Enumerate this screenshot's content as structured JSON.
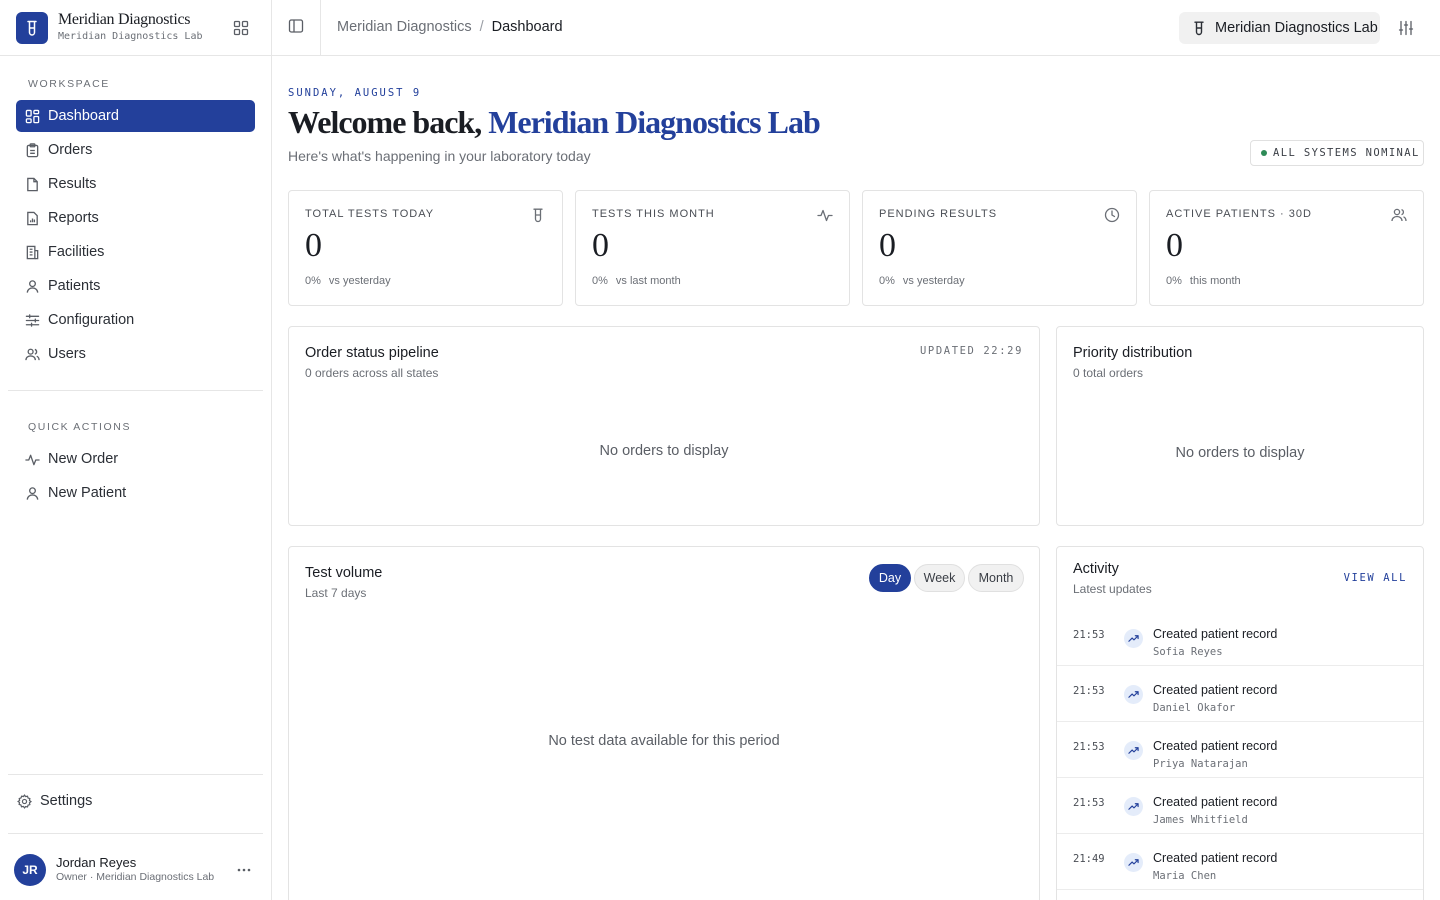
{
  "brand": {
    "name": "Meridian Diagnostics",
    "subtitle": "Meridian Diagnostics Lab"
  },
  "sidebar": {
    "workspace_label": "WORKSPACE",
    "items": [
      {
        "label": "Dashboard",
        "icon": "dashboard-icon",
        "active": true
      },
      {
        "label": "Orders",
        "icon": "clipboard-icon"
      },
      {
        "label": "Results",
        "icon": "file-icon"
      },
      {
        "label": "Reports",
        "icon": "report-icon"
      },
      {
        "label": "Facilities",
        "icon": "building-icon"
      },
      {
        "label": "Patients",
        "icon": "user-icon"
      },
      {
        "label": "Configuration",
        "icon": "sliders-icon"
      },
      {
        "label": "Users",
        "icon": "users-icon"
      }
    ],
    "quick_actions_label": "QUICK ACTIONS",
    "quick_actions": [
      {
        "label": "New Order",
        "icon": "activity-icon"
      },
      {
        "label": "New Patient",
        "icon": "user-icon"
      }
    ],
    "settings_label": "Settings",
    "user": {
      "initials": "JR",
      "name": "Jordan Reyes",
      "role": "Owner · Meridian Diagnostics Lab"
    }
  },
  "topbar": {
    "breadcrumb": {
      "parent": "Meridian Diagnostics",
      "separator": "/",
      "current": "Dashboard"
    },
    "lab_selector": "Meridian Diagnostics Lab"
  },
  "header": {
    "date": "SUNDAY, AUGUST 9",
    "welcome_prefix": "Welcome back,",
    "welcome_name": "Meridian Diagnostics Lab",
    "subtitle": "Here's what's happening in your laboratory today",
    "status": "ALL SYSTEMS NOMINAL",
    "status_color": "#2e8b57"
  },
  "stats": [
    {
      "label": "TOTAL TESTS TODAY",
      "value": "0",
      "pct": "0%",
      "compare": "vs yesterday",
      "icon": "test-tube-icon"
    },
    {
      "label": "TESTS THIS MONTH",
      "value": "0",
      "pct": "0%",
      "compare": "vs last month",
      "icon": "activity-icon"
    },
    {
      "label": "PENDING RESULTS",
      "value": "0",
      "pct": "0%",
      "compare": "vs yesterday",
      "icon": "clock-icon"
    },
    {
      "label": "ACTIVE PATIENTS · 30D",
      "value": "0",
      "pct": "0%",
      "compare": "this month",
      "icon": "users-icon"
    }
  ],
  "pipeline": {
    "title": "Order status pipeline",
    "subtitle": "0 orders across all states",
    "updated": "UPDATED 22:29",
    "empty": "No orders to display"
  },
  "priority": {
    "title": "Priority distribution",
    "subtitle": "0 total orders",
    "empty": "No orders to display"
  },
  "volume": {
    "title": "Test volume",
    "subtitle": "Last 7 days",
    "ranges": [
      "Day",
      "Week",
      "Month"
    ],
    "selected_range": "Day",
    "empty": "No test data available for this period"
  },
  "activity": {
    "title": "Activity",
    "subtitle": "Latest updates",
    "view_all": "VIEW ALL",
    "items": [
      {
        "time": "21:53",
        "title": "Created patient record",
        "name": "Sofia Reyes"
      },
      {
        "time": "21:53",
        "title": "Created patient record",
        "name": "Daniel Okafor"
      },
      {
        "time": "21:53",
        "title": "Created patient record",
        "name": "Priya Natarajan"
      },
      {
        "time": "21:53",
        "title": "Created patient record",
        "name": "James Whitfield"
      },
      {
        "time": "21:49",
        "title": "Created patient record",
        "name": "Maria Chen"
      }
    ]
  },
  "colors": {
    "accent": "#23409b",
    "border": "#e3e3e3",
    "muted_text": "#6b6f76",
    "activity_icon_bg": "#e4ecfa"
  }
}
